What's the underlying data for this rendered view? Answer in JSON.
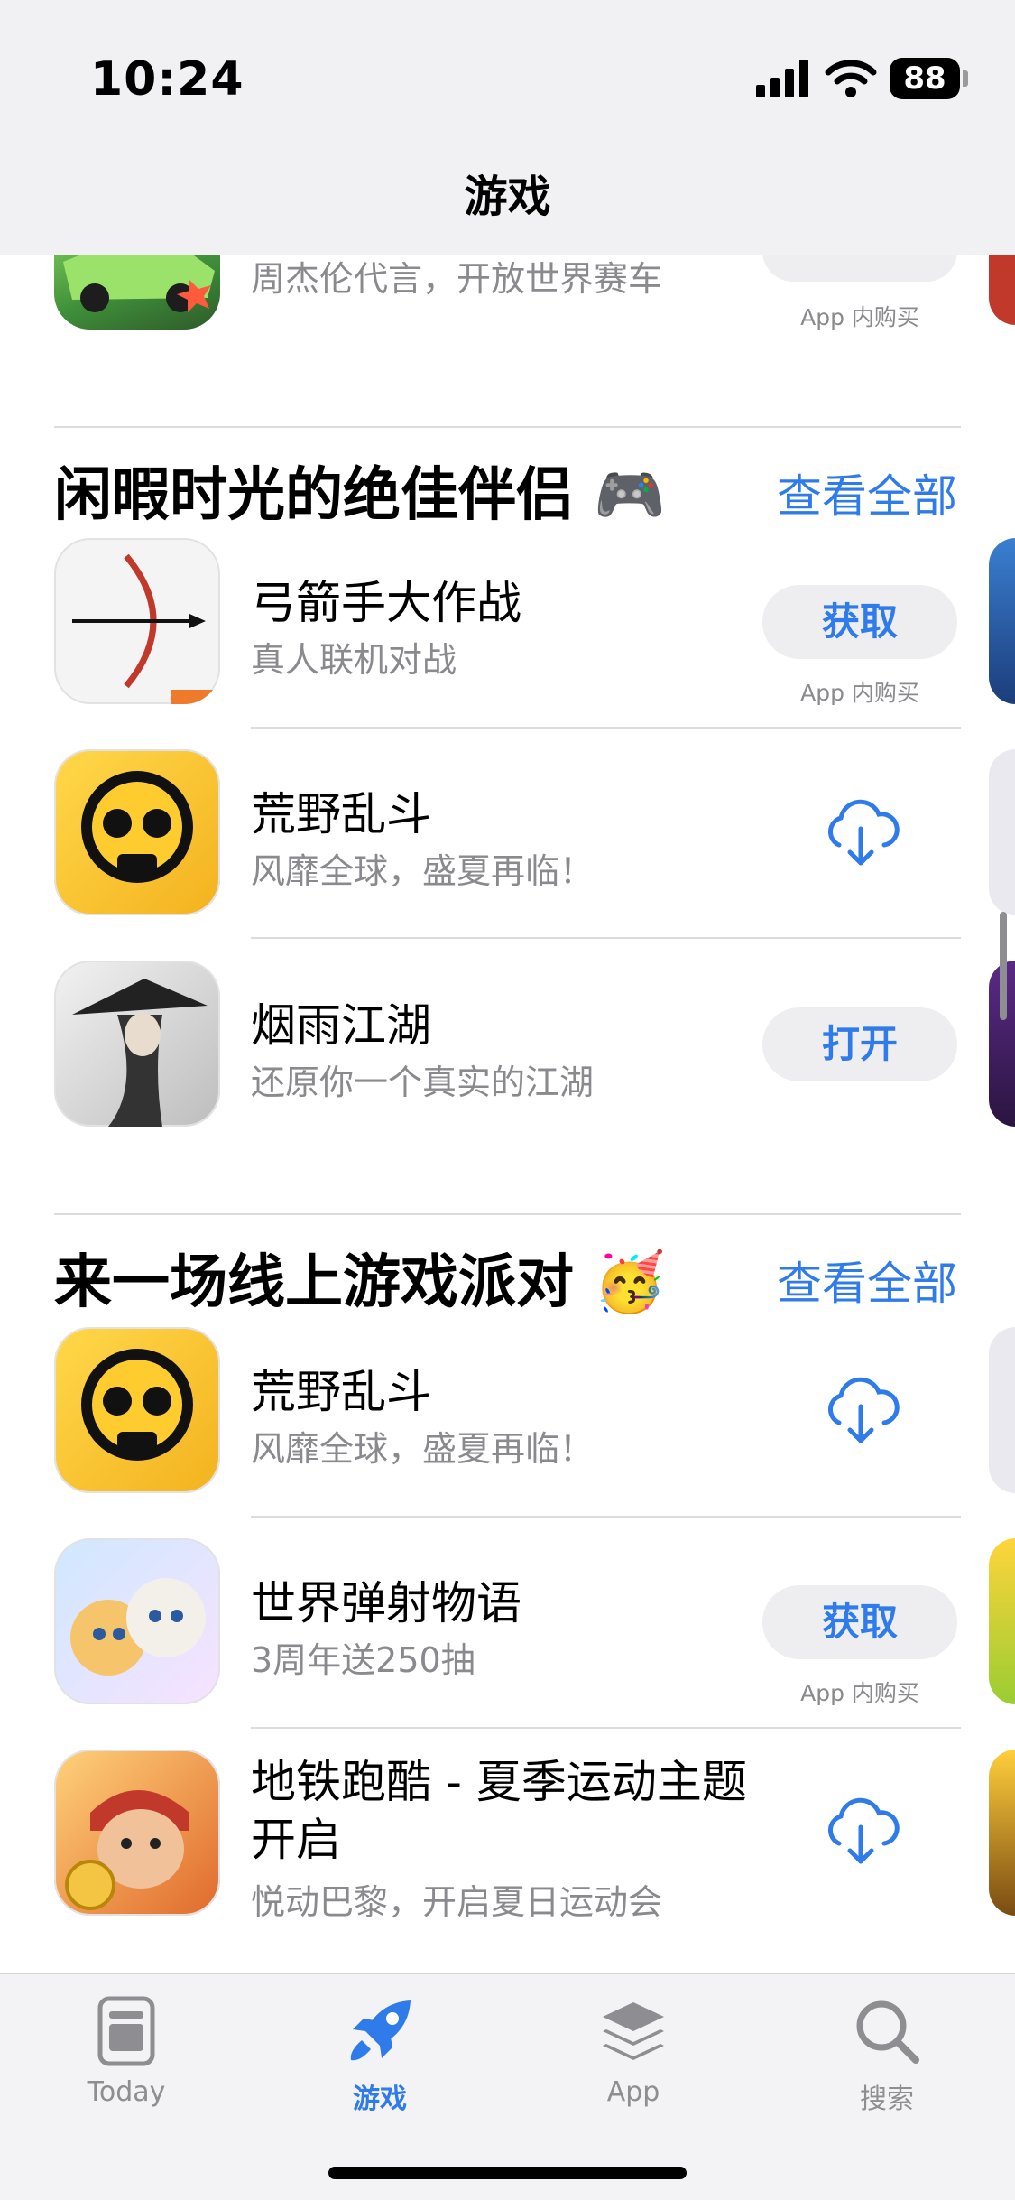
{
  "status": {
    "time": "10:24",
    "battery": "88"
  },
  "nav": {
    "title": "游戏"
  },
  "partial_row": {
    "subtitle": "周杰伦代言，开放世界赛车",
    "iap": "App 内购买"
  },
  "sections": [
    {
      "title": "闲暇时光的绝佳伴侣",
      "emoji": "🎮",
      "see_all": "查看全部",
      "apps": [
        {
          "name": "弓箭手大作战",
          "subtitle": "真人联机对战",
          "action": "获取",
          "iap": "App 内购买"
        },
        {
          "name": "荒野乱斗",
          "subtitle": "风靡全球，盛夏再临！",
          "action": "download-cloud-icon"
        },
        {
          "name": "烟雨江湖",
          "subtitle": "还原你一个真实的江湖",
          "action": "打开"
        }
      ]
    },
    {
      "title": "来一场线上游戏派对",
      "emoji": "🥳",
      "see_all": "查看全部",
      "apps": [
        {
          "name": "荒野乱斗",
          "subtitle": "风靡全球，盛夏再临！",
          "action": "download-cloud-icon"
        },
        {
          "name": "世界弹射物语",
          "subtitle": "3周年送250抽",
          "action": "获取",
          "iap": "App 内购买"
        },
        {
          "name": "地铁跑酷 - 夏季运动主题开启",
          "subtitle": "悦动巴黎，开启夏日运动会",
          "action": "download-cloud-icon"
        }
      ]
    }
  ],
  "tabs": [
    {
      "label": "Today",
      "icon": "today-icon",
      "active": false
    },
    {
      "label": "游戏",
      "icon": "rocket-icon",
      "active": true
    },
    {
      "label": "App",
      "icon": "apps-stack-icon",
      "active": false
    },
    {
      "label": "搜索",
      "icon": "search-icon",
      "active": false
    }
  ],
  "colors": {
    "accent": "#2f7bea",
    "secondary_text": "#8a8a8e",
    "pill_bg": "#eeeef0"
  }
}
